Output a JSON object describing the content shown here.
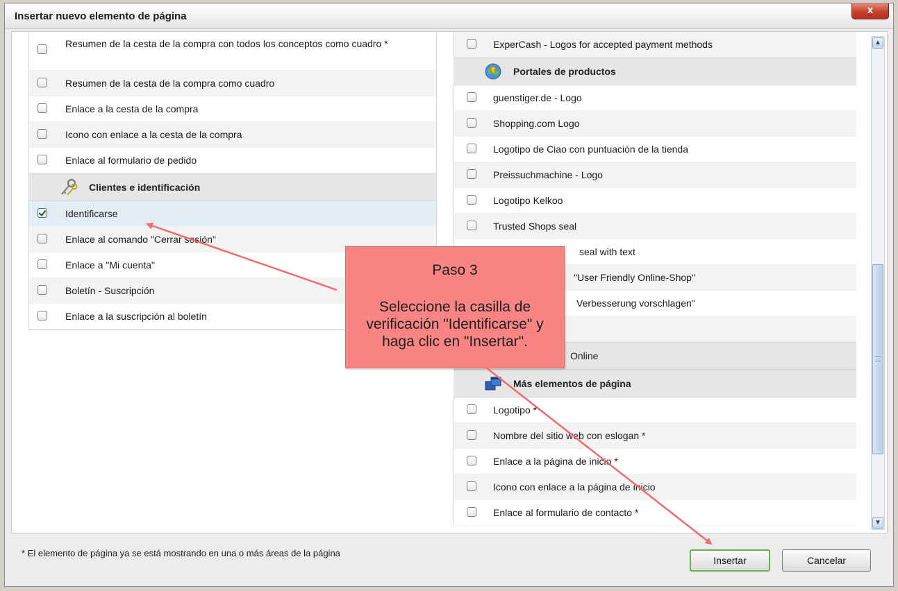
{
  "dialog": {
    "title": "Insertar nuevo elemento de página",
    "close_label": "x"
  },
  "left_column": {
    "top_items": [
      {
        "label": "Resumen de la cesta de la compra con todos los conceptos como cuadro *",
        "checked": false
      },
      {
        "label": "Resumen de la cesta de la compra como cuadro",
        "checked": false
      },
      {
        "label": "Enlace a la cesta de la compra",
        "checked": false
      },
      {
        "label": "Icono con enlace a la cesta de la compra",
        "checked": false
      },
      {
        "label": "Enlace al formulario de pedido",
        "checked": false
      }
    ],
    "customers_section": {
      "title": "Clientes e identificación",
      "icon": "keys-icon",
      "items": [
        {
          "label": "Identificarse",
          "checked": true
        },
        {
          "label": "Enlace al comando \"Cerrar sesión\"",
          "checked": false
        },
        {
          "label": "Enlace a \"Mi cuenta\"",
          "checked": false
        },
        {
          "label": "Boletín - Suscripción",
          "checked": false
        },
        {
          "label": "Enlace a la suscripción al boletín",
          "checked": false
        }
      ]
    }
  },
  "right_column": {
    "top_items": [
      {
        "label": "ExperCash - Logos for accepted payment methods",
        "checked": false
      }
    ],
    "portals_section": {
      "title": "Portales de productos",
      "icon": "globe-icon",
      "items": [
        {
          "label": "guenstiger.de - Logo",
          "checked": false
        },
        {
          "label": "Shopping.com Logo",
          "checked": false
        },
        {
          "label": "Logotipo de Ciao con puntuación de la tienda",
          "checked": false
        },
        {
          "label": "Preissuchmachine - Logo",
          "checked": false
        },
        {
          "label": "Logotipo Kelkoo",
          "checked": false
        },
        {
          "label": "Trusted Shops seal",
          "checked": false
        },
        {
          "label": "seal with text",
          "checked": false
        },
        {
          "label": "\"User Friendly Online-Shop\"",
          "checked": false
        },
        {
          "label": "Verbesserung vorschlagen\"",
          "checked": false
        },
        {
          "label": "",
          "checked": false
        }
      ],
      "partial_header": "Online"
    },
    "more_section": {
      "title": "Más elementos de página",
      "icon": "windows-icon",
      "items": [
        {
          "label": "Logotipo *",
          "checked": false
        },
        {
          "label": "Nombre del sitio web con eslogan *",
          "checked": false
        },
        {
          "label": "Enlace a la página de inicio *",
          "checked": false
        },
        {
          "label": "Icono con enlace a la página de inicio",
          "checked": false
        },
        {
          "label": "Enlace al formulario de contacto *",
          "checked": false
        }
      ]
    }
  },
  "scrollbar": {
    "up_label": "▲",
    "down_label": "▼"
  },
  "footer": {
    "note": "* El elemento de página ya se está mostrando en una o más áreas de la página",
    "insert_label": "Insertar",
    "cancel_label": "Cancelar"
  },
  "callout": {
    "title": "Paso 3",
    "body": "Seleccione la casilla de verificación \"Identificarse\" y haga clic en \"Insertar\"."
  },
  "colors": {
    "callout_bg": "#f88483",
    "arrow": "#f26a6a",
    "insert_border": "#65b24c",
    "selected_row": "#e3edf6"
  }
}
